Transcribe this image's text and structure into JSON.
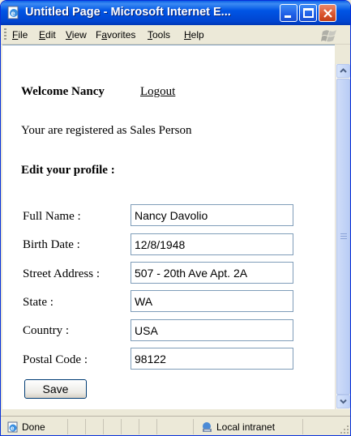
{
  "window": {
    "title": "Untitled Page - Microsoft Internet E...",
    "app_icon": "ie-page-icon",
    "controls": [
      "minimize",
      "maximize",
      "close"
    ]
  },
  "menubar": {
    "items": [
      {
        "label": "File",
        "accel": "F"
      },
      {
        "label": "Edit",
        "accel": "E"
      },
      {
        "label": "View",
        "accel": "V"
      },
      {
        "label": "Favorites",
        "accel": "a"
      },
      {
        "label": "Tools",
        "accel": "T"
      },
      {
        "label": "Help",
        "accel": "H"
      }
    ],
    "logo": "windows-flag-icon"
  },
  "page": {
    "welcome_text": "Welcome Nancy",
    "logout_link": "Logout",
    "registered_text": "Your are registered as Sales Person",
    "edit_title": "Edit your profile :",
    "fields": [
      {
        "label": "Full Name :",
        "value": "Nancy Davolio"
      },
      {
        "label": "Birth Date :",
        "value": "12/8/1948"
      },
      {
        "label": "Street Address :",
        "value": "507 - 20th Ave Apt. 2A"
      },
      {
        "label": "State :",
        "value": "WA"
      },
      {
        "label": "Country :",
        "value": "USA"
      },
      {
        "label": "Postal Code :",
        "value": "98122"
      }
    ],
    "save_label": "Save"
  },
  "statusbar": {
    "status": "Done",
    "zone": "Local intranet"
  },
  "colors": {
    "titlebar": "#0055e5",
    "chrome": "#ece9d8",
    "input_border": "#7f9db9"
  }
}
